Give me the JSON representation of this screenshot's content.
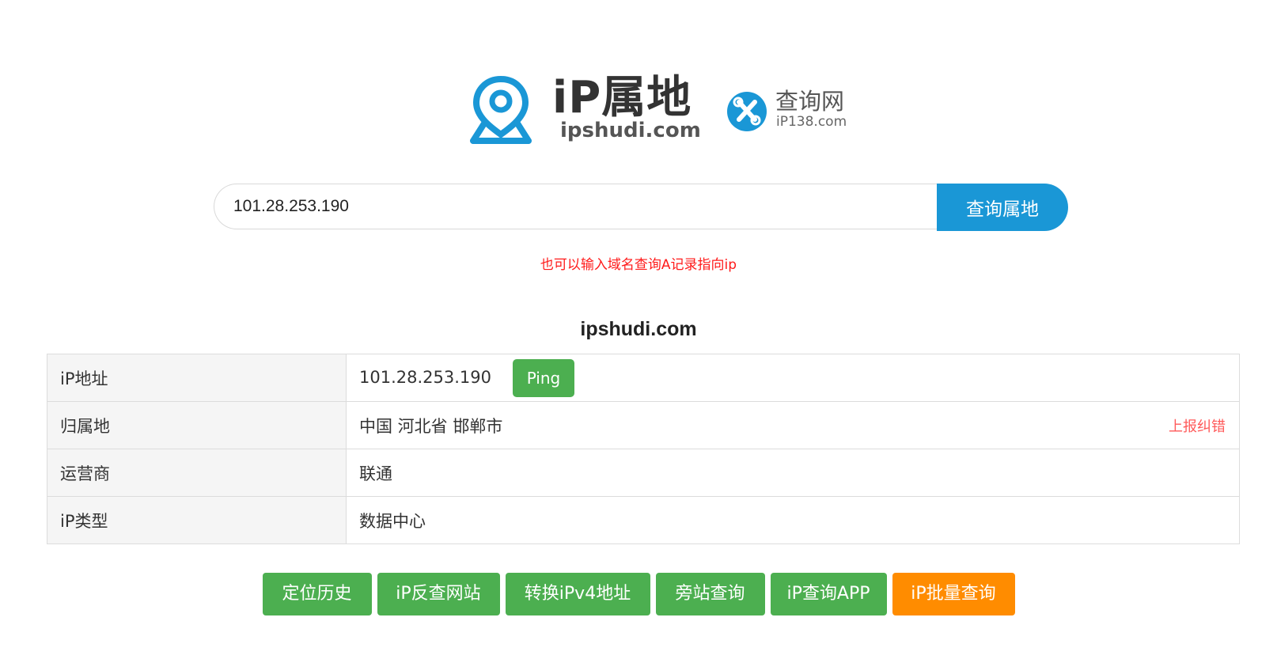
{
  "logo": {
    "main_text": "iP属地",
    "main_sub": "ipshudi.com",
    "secondary_title": "查询网",
    "secondary_sub": "iP138.com"
  },
  "search": {
    "value": "101.28.253.190",
    "button_label": "查询属地",
    "hint": "也可以输入域名查询A记录指向ip"
  },
  "result": {
    "title": "ipshudi.com",
    "rows": [
      {
        "label": "iP地址",
        "value": "101.28.253.190"
      },
      {
        "label": "归属地",
        "value": "中国 河北省 邯郸市"
      },
      {
        "label": "运营商",
        "value": "联通"
      },
      {
        "label": "iP类型",
        "value": "数据中心"
      }
    ],
    "ping_label": "Ping",
    "report_label": "上报纠错"
  },
  "actions": [
    {
      "label": "定位历史",
      "color": "#4caf50"
    },
    {
      "label": "iP反查网站",
      "color": "#4caf50"
    },
    {
      "label": "转换iPv4地址",
      "color": "#4caf50"
    },
    {
      "label": "旁站查询",
      "color": "#4caf50"
    },
    {
      "label": "iP查询APP",
      "color": "#4caf50"
    },
    {
      "label": "iP批量查询",
      "color": "#ff8c00"
    }
  ],
  "colors": {
    "accent": "#1a97d6",
    "green": "#4caf50",
    "orange": "#ff8c00",
    "hint_red": "#ff1a1a"
  }
}
